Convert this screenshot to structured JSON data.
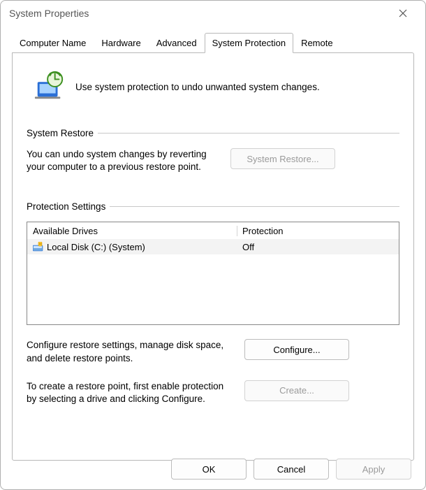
{
  "window": {
    "title": "System Properties"
  },
  "tabs": {
    "computer_name": "Computer Name",
    "hardware": "Hardware",
    "advanced": "Advanced",
    "system_protection": "System Protection",
    "remote": "Remote"
  },
  "intro": {
    "text": "Use system protection to undo unwanted system changes."
  },
  "system_restore": {
    "legend": "System Restore",
    "desc": "You can undo system changes by reverting your computer to a previous restore point.",
    "button": "System Restore..."
  },
  "protection_settings": {
    "legend": "Protection Settings",
    "table": {
      "header_drives": "Available Drives",
      "header_protection": "Protection",
      "rows": [
        {
          "name": "Local Disk (C:) (System)",
          "protection": "Off"
        }
      ]
    },
    "configure_desc": "Configure restore settings, manage disk space, and delete restore points.",
    "configure_button": "Configure...",
    "create_desc": "To create a restore point, first enable protection by selecting a drive and clicking Configure.",
    "create_button": "Create..."
  },
  "buttons": {
    "ok": "OK",
    "cancel": "Cancel",
    "apply": "Apply"
  }
}
